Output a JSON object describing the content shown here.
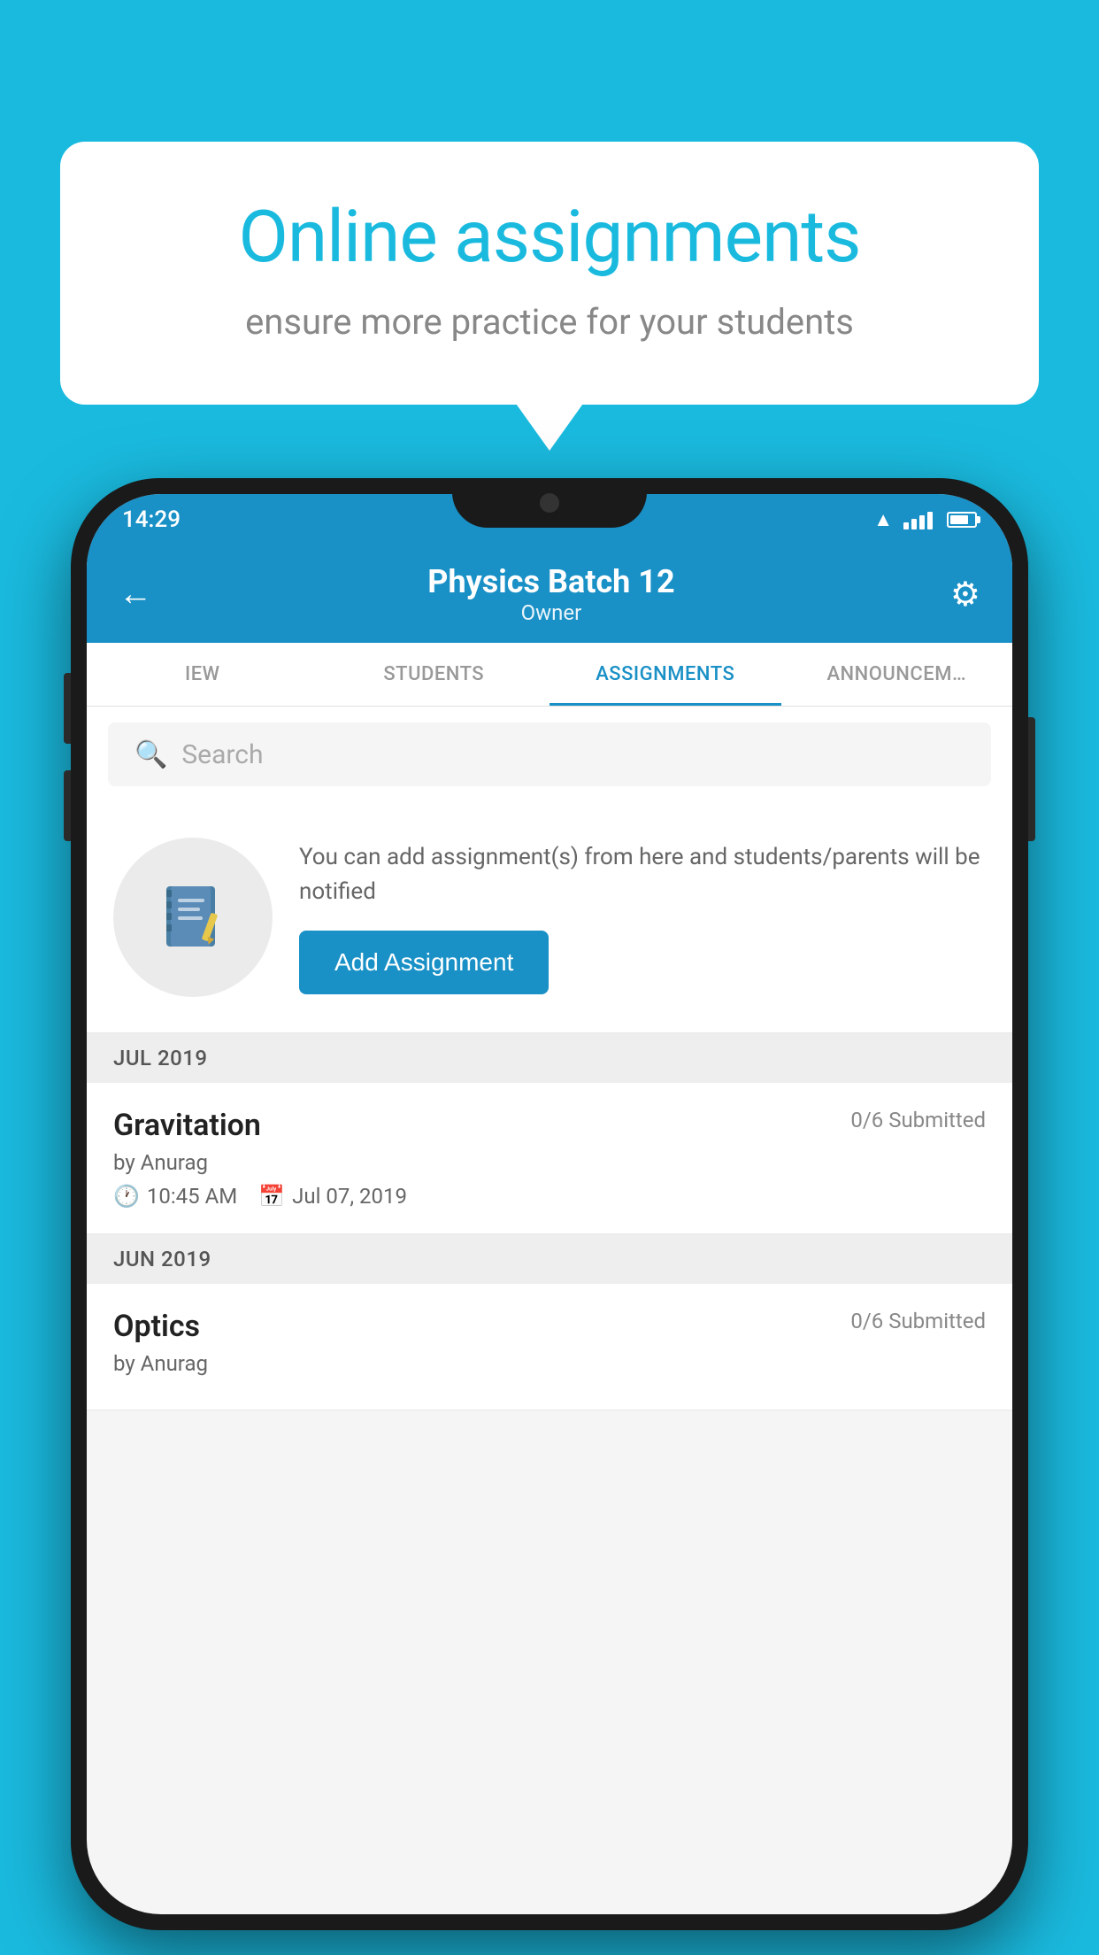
{
  "background_color": "#1ABADF",
  "speech_bubble": {
    "title": "Online assignments",
    "subtitle": "ensure more practice for your students"
  },
  "status_bar": {
    "time": "14:29"
  },
  "app_header": {
    "title": "Physics Batch 12",
    "subtitle": "Owner",
    "back_label": "←",
    "settings_label": "⚙"
  },
  "tabs": [
    {
      "label": "IEW",
      "active": false
    },
    {
      "label": "STUDENTS",
      "active": false
    },
    {
      "label": "ASSIGNMENTS",
      "active": true
    },
    {
      "label": "ANNOUNCEM…",
      "active": false
    }
  ],
  "search": {
    "placeholder": "Search"
  },
  "promo": {
    "text": "You can add assignment(s) from here and students/parents will be notified",
    "button_label": "Add Assignment"
  },
  "sections": [
    {
      "month": "JUL 2019",
      "assignments": [
        {
          "title": "Gravitation",
          "submitted": "0/6 Submitted",
          "by": "by Anurag",
          "time": "10:45 AM",
          "date": "Jul 07, 2019"
        }
      ]
    },
    {
      "month": "JUN 2019",
      "assignments": [
        {
          "title": "Optics",
          "submitted": "0/6 Submitted",
          "by": "by Anurag",
          "time": "",
          "date": ""
        }
      ]
    }
  ]
}
